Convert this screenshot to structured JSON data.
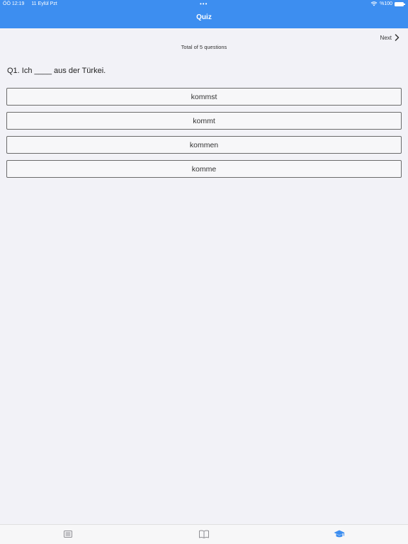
{
  "status_bar": {
    "time": "ÖÖ 12:19",
    "date": "11 Eylül Pzt",
    "battery": "%100"
  },
  "header": {
    "title": "Quiz"
  },
  "navigation": {
    "next_label": "Next"
  },
  "quiz": {
    "total_label": "Total of 5 questions",
    "question": "Q1. Ich ____ aus der Türkei.",
    "options": [
      "kommst",
      "kommt",
      "kommen",
      "komme"
    ]
  },
  "tabbar": {
    "tabs": [
      {
        "icon": "list-icon"
      },
      {
        "icon": "book-icon"
      },
      {
        "icon": "graduation-cap-icon",
        "active": true
      }
    ]
  },
  "colors": {
    "accent": "#3d8ef0",
    "background": "#f2f2f7",
    "tab_inactive": "#8e8e93"
  }
}
